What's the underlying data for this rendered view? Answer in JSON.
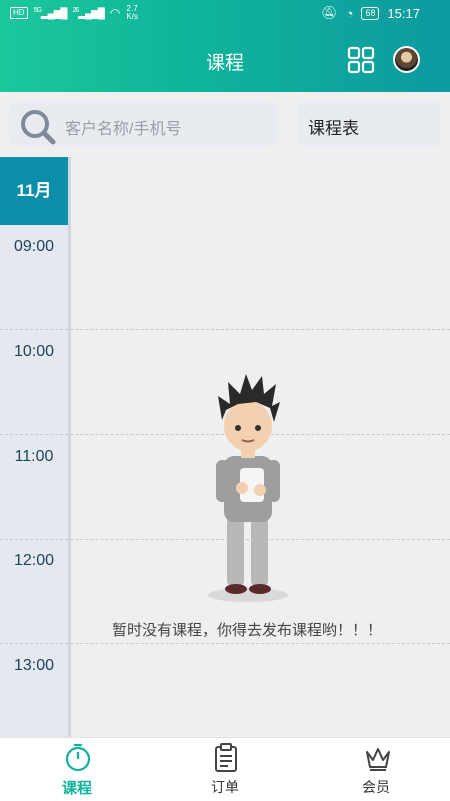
{
  "status_bar": {
    "hd": "HD",
    "signal1": "5G",
    "signal2": "26",
    "net_speed": "2.7",
    "net_unit": "K/s",
    "battery": "68",
    "time": "15:17"
  },
  "header": {
    "title": "课程"
  },
  "search": {
    "placeholder": "客户名称/手机号"
  },
  "schedule_button": "课程表",
  "calendar": {
    "month": "11月",
    "times": [
      "09:00",
      "10:00",
      "11:00",
      "12:00",
      "13:00"
    ]
  },
  "empty_message": "暂时没有课程，你得去发布课程哟！！！",
  "tabs": [
    {
      "label": "课程",
      "icon": "course-icon",
      "active": true
    },
    {
      "label": "订单",
      "icon": "order-icon",
      "active": false
    },
    {
      "label": "会员",
      "icon": "member-crown-icon",
      "active": false
    }
  ],
  "colors": {
    "primary": "#10b29c",
    "month_bg": "#0b8ea9"
  }
}
